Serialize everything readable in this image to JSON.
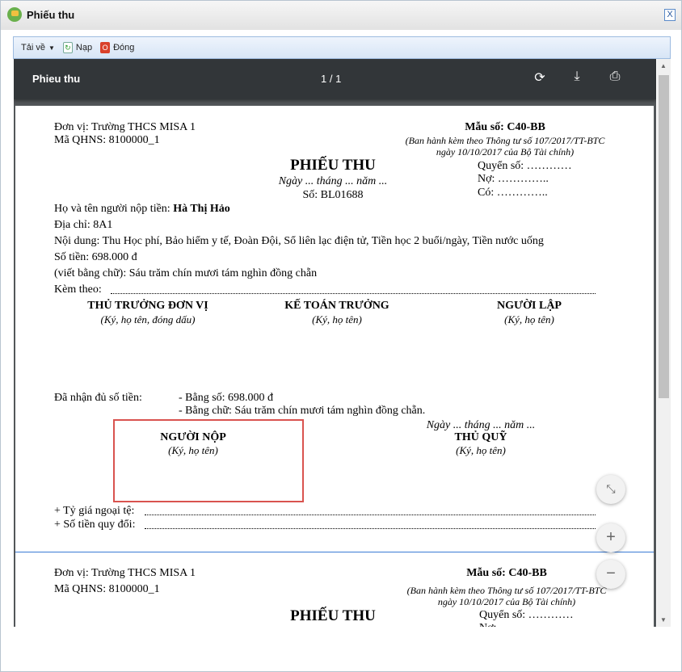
{
  "window": {
    "title": "Phiếu thu",
    "close": "X"
  },
  "toolbar": {
    "download": "Tải về",
    "reload": "Nạp",
    "close": "Đóng"
  },
  "viewer": {
    "title": "Phieu thu",
    "page": "1 / 1"
  },
  "doc": {
    "unit": "Đơn vị: Trường THCS MISA 1",
    "qhns": "Mã QHNS: 8100000_1",
    "form_no": "Mẫu số: C40-BB",
    "issued1": "(Ban hành kèm theo Thông tư số 107/2017/TT-BTC",
    "issued2": "ngày 10/10/2017 của Bộ Tài chính)",
    "heading": "PHIẾU THU",
    "date": "Ngày ... tháng ... năm ...",
    "number": "Số: BL01688",
    "book": "Quyển số: …………",
    "debit": "Nợ: …………..",
    "credit": "Có: …………..",
    "payer_label": "Họ và tên người nộp tiền: ",
    "payer": "Hà Thị Hảo",
    "address": "Địa chỉ: 8A1",
    "content": "Nội dung: Thu Học phí, Bảo hiểm y tế, Đoàn Đội, Sổ liên lạc điện tử, Tiền học 2 buổi/ngày, Tiền nước uống",
    "amount": "Số tiền: 698.000 đ",
    "amount_words": "(viết bằng chữ): Sáu trăm chín mươi tám nghìn đồng chẵn",
    "attached": "Kèm theo:",
    "sig_head": "THỦ TRƯỞNG ĐƠN VỊ",
    "sig_head_note": "(Ký, họ tên, đóng dấu)",
    "sig_acc": "KẾ TOÁN TRƯỞNG",
    "sig_acc_note": "(Ký, họ tên)",
    "sig_maker": "NGƯỜI LẬP",
    "sig_maker_note": "(Ký, họ tên)",
    "received": "Đã nhận đủ số tiền:",
    "recv_num": "- Bằng số: 698.000 đ",
    "recv_words": "- Bằng chữ: Sáu trăm chín mươi tám nghìn đồng chẵn.",
    "date2": "Ngày ... tháng ... năm ...",
    "sig_payer": "NGƯỜI NỘP",
    "sig_payer_note": "(Ký, họ tên)",
    "sig_cashier": "THỦ QUỸ",
    "sig_cashier_note": "(Ký, họ tên)",
    "fx_rate": "+ Tỷ giá ngoại tệ:",
    "converted": "+ Số tiền quy đổi:"
  }
}
